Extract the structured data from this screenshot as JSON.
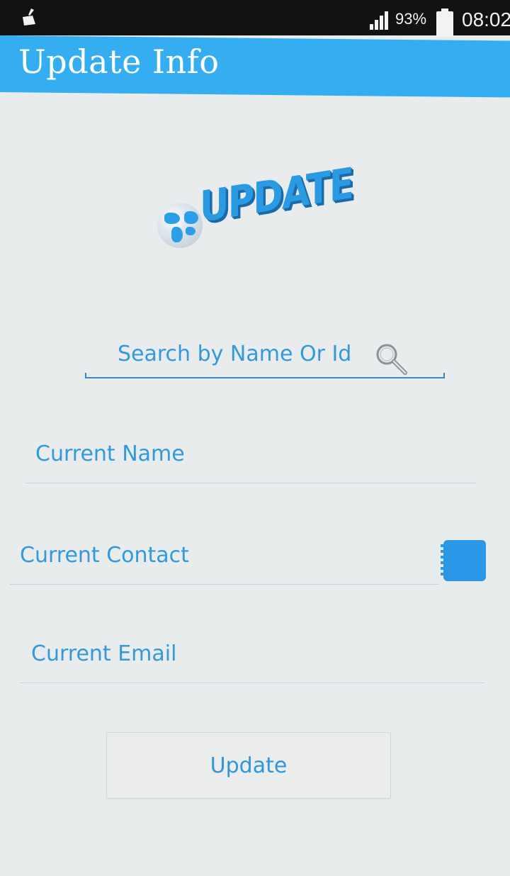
{
  "status_bar": {
    "battery_percent": "93%",
    "time": "08:02",
    "icons": [
      "cleaner-icon",
      "signal-icon",
      "battery-icon"
    ]
  },
  "app_bar": {
    "title": "Update Info",
    "color": "#34aef0"
  },
  "hero": {
    "text": "UPDATE",
    "icon": "globe-icon"
  },
  "search": {
    "placeholder": "Search by Name Or Id",
    "value": "",
    "icon": "search-icon"
  },
  "form": {
    "name_placeholder": "Current Name",
    "contact_placeholder": "Current Contact",
    "email_placeholder": "Current Email",
    "contact_picker_icon": "contact-book-icon"
  },
  "actions": {
    "update_label": "Update"
  },
  "colors": {
    "accent": "#34aef0",
    "text_blue": "#2f97da",
    "background": "#e9ecec"
  }
}
